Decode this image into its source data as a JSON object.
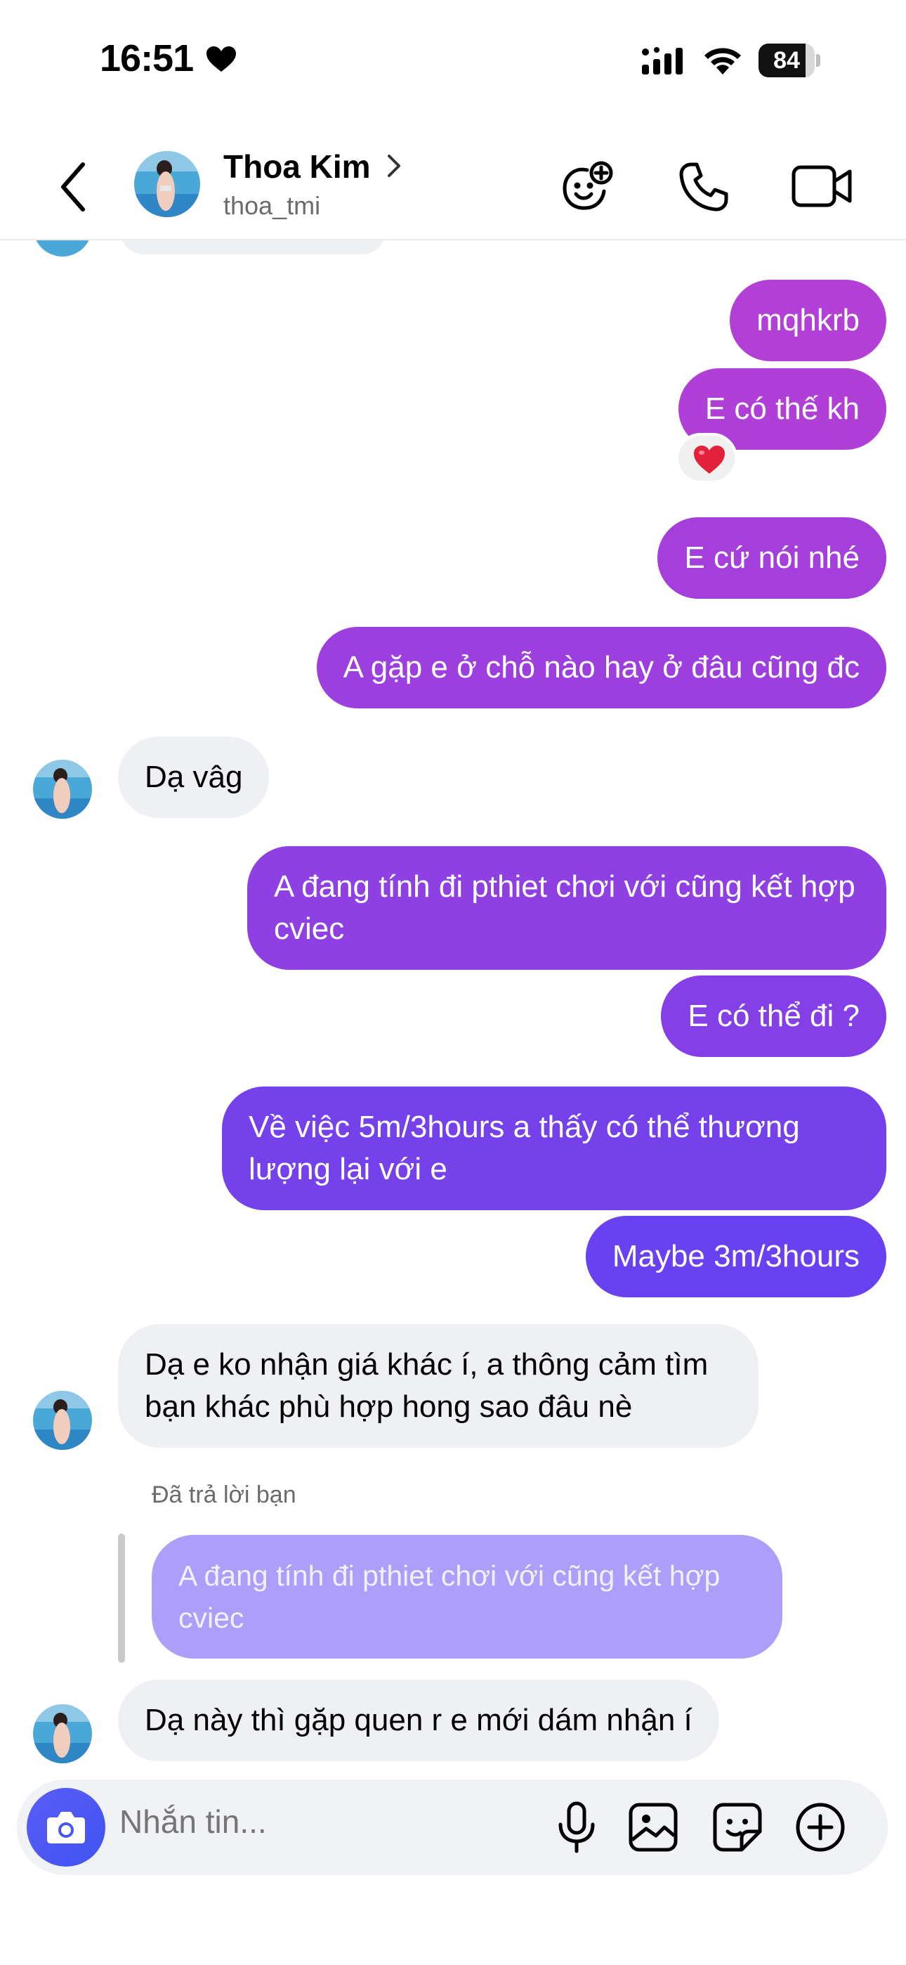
{
  "status_bar": {
    "time": "16:51",
    "battery": "84",
    "battery_level": 0.84
  },
  "header": {
    "name": "Thoa Kim",
    "username": "thoa_tmi"
  },
  "messages": {
    "m1": "mqhkrb",
    "m2": "E có thế kh",
    "m2_reaction": "❤️",
    "m3": "E cứ nói nhé",
    "m4": "A gặp e ở chỗ nào hay ở đâu cũng đc",
    "m5": "Dạ vâg",
    "m6": "A đang tính đi pthiet chơi với cũng kết hợp cviec",
    "m7": "E có thể đi ?",
    "m8": "Về việc 5m/3hours a thấy có thể thương lượng lại với e",
    "m9": "Maybe 3m/3hours",
    "m10": "Dạ e ko nhận giá khác í, a thông cảm tìm bạn khác phù hợp hong sao đâu nè",
    "reply_label": "Đã trả lời bạn",
    "reply_quote": "A đang tính đi pthiet chơi với cũng kết hợp cviec",
    "m11": "Dạ này thì gặp quen r e mới dám nhận í"
  },
  "composer": {
    "placeholder": "Nhắn tin..."
  },
  "colors": {
    "outgoing_top": "#b23fd6",
    "outgoing_bottom": "#6541f2",
    "incoming": "#eef0f3",
    "accent": "#4a56f2"
  }
}
